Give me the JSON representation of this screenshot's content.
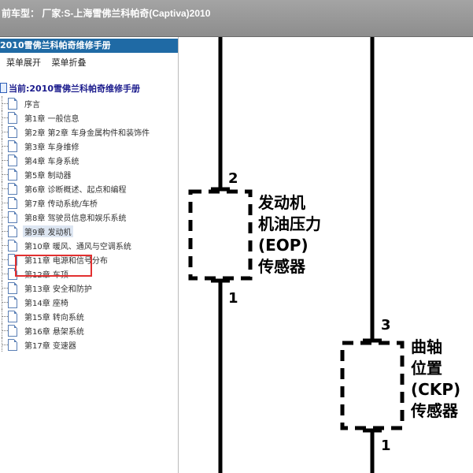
{
  "titlebar": {
    "text": "前车型：  厂家:S-上海雪佛兰科帕奇(Captiva)2010"
  },
  "sidebar": {
    "header": "2010雪佛兰科帕奇维修手册",
    "tools": [
      "菜单展开",
      "菜单折叠"
    ],
    "current": "当前:2010雪佛兰科帕奇维修手册",
    "items": [
      "序言",
      "第1章 一般信息",
      "第2章 第2章 车身金属构件和装饰件",
      "第3章 车身维修",
      "第4章 车身系统",
      "第5章 制动器",
      "第6章 诊断概述、起点和编程",
      "第7章 传动系统/车桥",
      "第8章 驾驶员信息和娱乐系统",
      "第9章 发动机",
      "第10章 暖风、通风与空调系统",
      "第11章 电源和信号分布",
      "第12章 车顶",
      "第13章 安全和防护",
      "第14章 座椅",
      "第15章 转向系统",
      "第16章 悬架系统",
      "第17章 变速器"
    ]
  },
  "diagram": {
    "eop": {
      "pin_top": "2",
      "pin_bottom": "1",
      "lines": [
        "发动机",
        "机油压力",
        "(EOP)",
        "传感器"
      ]
    },
    "ckp": {
      "pin_top": "3",
      "pin_bottom": "1",
      "lines": [
        "曲轴",
        "位置",
        "(CKP)",
        "传感器"
      ]
    }
  }
}
